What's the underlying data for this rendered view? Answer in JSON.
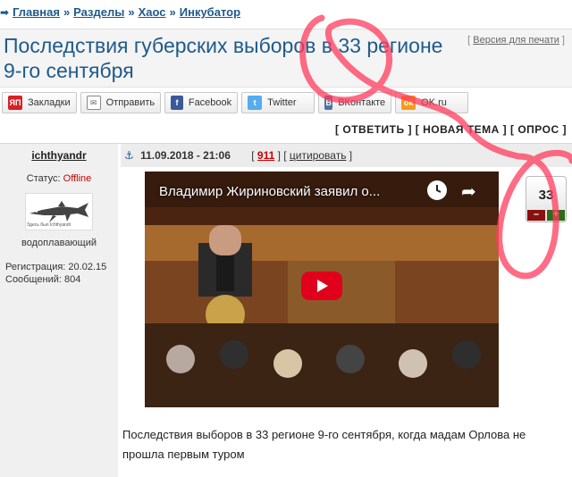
{
  "breadcrumb": {
    "items": [
      "Главная",
      "Разделы",
      "Хаос",
      "Инкубатор"
    ],
    "separator": "»"
  },
  "page": {
    "title": "Последствия губерских выборов в 33 регионе 9-го сентября",
    "print_link": "Версия для печати"
  },
  "share": {
    "buttons": [
      {
        "label": "Закладки",
        "icon": "yandex-bookmarks-icon",
        "color": "#d81f26"
      },
      {
        "label": "Отправить",
        "icon": "mail-icon",
        "color": "#7a7a7a"
      },
      {
        "label": "Facebook",
        "icon": "facebook-icon",
        "color": "#3b5998"
      },
      {
        "label": "Twitter",
        "icon": "twitter-icon",
        "color": "#55acee"
      },
      {
        "label": "ВКонтакте",
        "icon": "vk-icon",
        "color": "#4c75a3"
      },
      {
        "label": "OK.ru",
        "icon": "odnoklassniki-icon",
        "color": "#f59a1e"
      }
    ]
  },
  "actions": {
    "reply": "ОТВЕТИТЬ",
    "new_topic": "НОВАЯ ТЕМА",
    "poll": "ОПРОС"
  },
  "post": {
    "author": "ichthyandr",
    "datetime": "11.09.2018 - 21:06",
    "number": "911",
    "cite": "цитировать",
    "status_label": "Статус:",
    "status_value": "Offline",
    "avatar_caption": "Здесь был Ichthyandr",
    "rank": "водоплавающий",
    "registration": "Регистрация: 20.02.15",
    "messages": "Сообщений: 804",
    "video_title": "Владимир Жириновский заявил о...",
    "rating": "33",
    "text": "Последствия выборов в 33 регионе 9-го сентября, когда мадам Орлова не прошла первым туром"
  },
  "colors": {
    "link": "#1f5a8a",
    "offline": "#cc0000",
    "annotation": "#ff3b5c"
  }
}
